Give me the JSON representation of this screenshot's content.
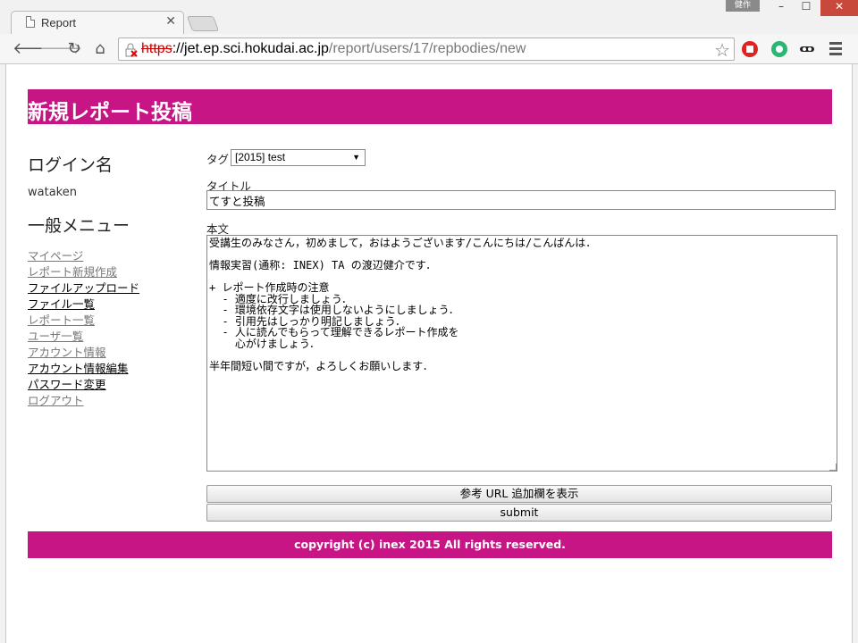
{
  "browser": {
    "tab_title": "Report",
    "profile_label": "健作",
    "url_scheme": "https",
    "url_host": "://jet.ep.sci.hokudai.ac.jp",
    "url_path": "/report/users/17/repbodies/new"
  },
  "page": {
    "title": "新規レポート投稿"
  },
  "sidebar": {
    "login_heading": "ログイン名",
    "login_name": "wataken",
    "menu_heading": "一般メニュー",
    "items": [
      {
        "label": "マイページ",
        "visited": true
      },
      {
        "label": "レポート新規作成",
        "visited": true
      },
      {
        "label": "ファイルアップロード",
        "visited": false
      },
      {
        "label": "ファイル一覧",
        "visited": false
      },
      {
        "label": "レポート一覧",
        "visited": true
      },
      {
        "label": "ユーザ一覧",
        "visited": true
      },
      {
        "label": "アカウント情報",
        "visited": true
      },
      {
        "label": "アカウント情報編集",
        "visited": false
      },
      {
        "label": "パスワード変更",
        "visited": false
      },
      {
        "label": "ログアウト",
        "visited": true
      }
    ]
  },
  "form": {
    "tag_label": "タグ",
    "tag_selected": "[2015] test",
    "title_label": "タイトル",
    "title_value": "てすと投稿",
    "body_label": "本文",
    "body_value": "受講生のみなさん，初めまして，おはようございます/こんにちは/こんばんは．\n\n情報実習(通称: INEX) TA の渡辺健介です．\n\n+ レポート作成時の注意\n  - 適度に改行しましょう．\n  - 環境依存文字は使用しないようにしましょう．\n  - 引用先はしっかり明記しましょう．\n  - 人に読んでもらって理解できるレポート作成を\n    心がけましょう．\n\n半年間短い間ですが，よろしくお願いします．",
    "show_url_button": "参考 URL 追加欄を表示",
    "submit_button": "submit"
  },
  "footer": {
    "text": "copyright (c) inex 2015 All rights reserved."
  },
  "colors": {
    "accent": "#c71585",
    "visited_link": "#777777"
  }
}
